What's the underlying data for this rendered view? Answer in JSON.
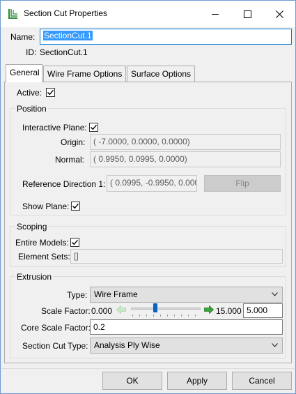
{
  "window": {
    "title": "Section Cut Properties",
    "controls": {
      "minimize": "minimize",
      "maximize": "maximize",
      "close": "close"
    }
  },
  "header": {
    "name_label": "Name:",
    "name_value": "SectionCut.1",
    "id_label": "ID:",
    "id_value": "SectionCut.1"
  },
  "tabs": [
    {
      "label": "General",
      "active": true
    },
    {
      "label": "Wire Frame Options",
      "active": false
    },
    {
      "label": "Surface Options",
      "active": false
    }
  ],
  "general": {
    "active_label": "Active:",
    "active_checked": true,
    "position": {
      "title": "Position",
      "interactive_plane_label": "Interactive Plane:",
      "interactive_plane_checked": true,
      "origin_label": "Origin:",
      "origin_value": "( -7.0000, 0.0000, 0.0000)",
      "normal_label": "Normal:",
      "normal_value": "( 0.9950, 0.0995, 0.0000)",
      "ref_dir_label": "Reference Direction 1:",
      "ref_dir_value": "( 0.0995, -0.9950, 0.0000",
      "flip_label": "Flip",
      "show_plane_label": "Show Plane:",
      "show_plane_checked": true
    },
    "scoping": {
      "title": "Scoping",
      "entire_models_label": "Entire Models:",
      "entire_models_checked": true,
      "element_sets_label": "Element Sets:",
      "element_sets_value": "[]"
    },
    "extrusion": {
      "title": "Extrusion",
      "type_label": "Type:",
      "type_value": "Wire Frame",
      "scale_factor_label": "Scale Factor:",
      "scale_min": "0.000",
      "scale_max": "15.000",
      "scale_value": "5.000",
      "scale_fraction": 0.333,
      "core_scale_label": "Core Scale Factor:",
      "core_scale_value": "0.2",
      "section_cut_type_label": "Section Cut Type:",
      "section_cut_type_value": "Analysis Ply Wise"
    }
  },
  "footer": {
    "ok_label": "OK",
    "apply_label": "Apply",
    "cancel_label": "Cancel"
  },
  "colors": {
    "accent": "#0078d7",
    "selection": "#3399ff",
    "slider_thumb": "#0a63c2",
    "arrow_green": "#3aa53a"
  }
}
